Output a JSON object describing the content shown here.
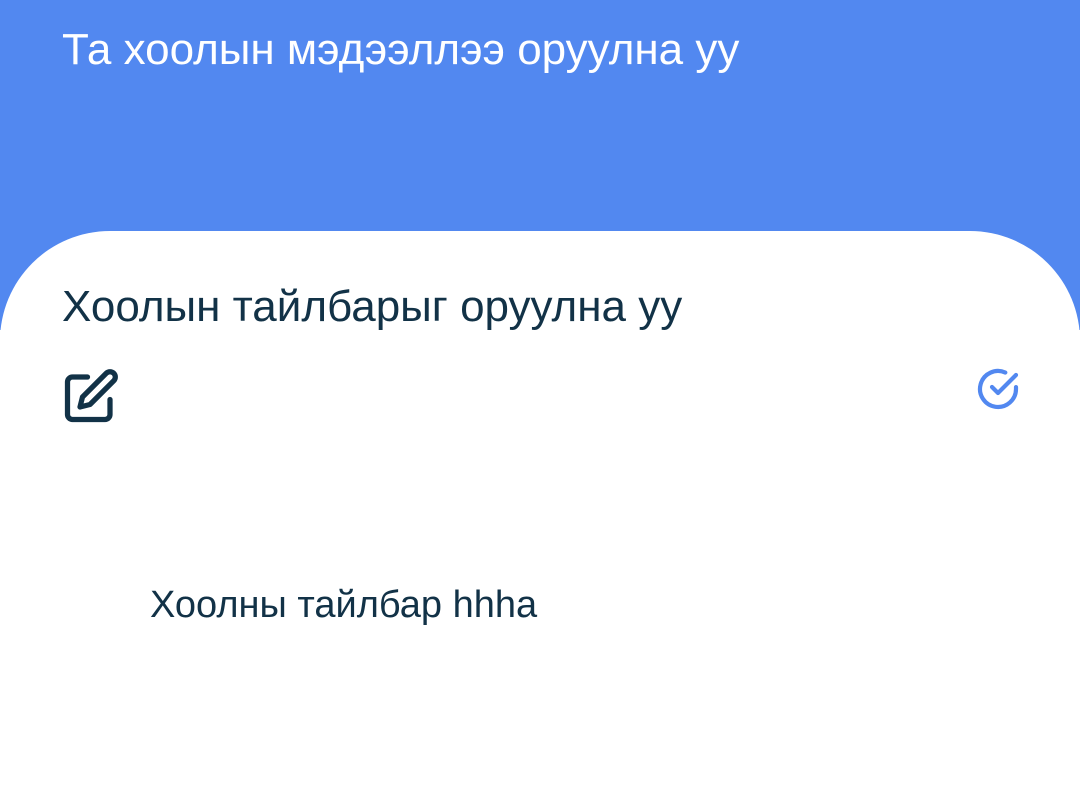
{
  "header": {
    "title": "Та хоолын мэдээллээ оруулна уу",
    "background_color": "#5288F0"
  },
  "form": {
    "section_title": "Хоолын тайлбарыг оруулна уу",
    "edit_icon": "edit-square-pencil-icon",
    "confirm_icon": "check-circle-icon",
    "description_value": "Хоолны тайлбар hhha",
    "text_color": "#123247",
    "accent_color": "#5288F0"
  }
}
